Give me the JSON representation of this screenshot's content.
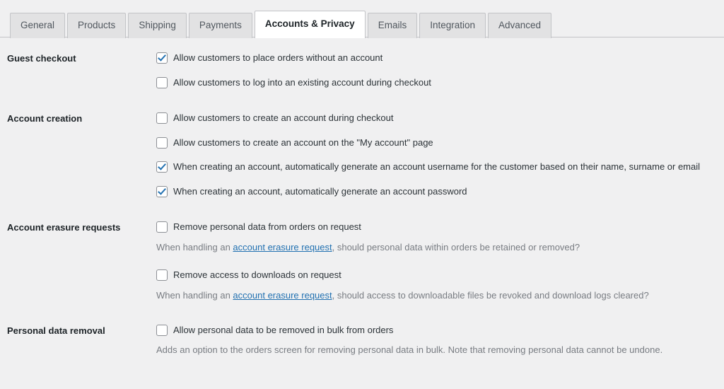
{
  "tabs": [
    {
      "label": "General",
      "active": false
    },
    {
      "label": "Products",
      "active": false
    },
    {
      "label": "Shipping",
      "active": false
    },
    {
      "label": "Payments",
      "active": false
    },
    {
      "label": "Accounts & Privacy",
      "active": true
    },
    {
      "label": "Emails",
      "active": false
    },
    {
      "label": "Integration",
      "active": false
    },
    {
      "label": "Advanced",
      "active": false
    }
  ],
  "colors": {
    "page_background": "#f0f0f1",
    "tab_inactive_background": "#e2e2e3",
    "tab_active_background": "#ffffff",
    "border": "#c3c4c7",
    "checkmark": "#2271b1",
    "link": "#2271b1",
    "label_text": "#1d2327",
    "body_text": "#2c3338",
    "description_text": "#787c82"
  },
  "sections": {
    "guest_checkout": {
      "label": "Guest checkout",
      "options": [
        {
          "label": "Allow customers to place orders without an account",
          "checked": true
        },
        {
          "label": "Allow customers to log into an existing account during checkout",
          "checked": false
        }
      ]
    },
    "account_creation": {
      "label": "Account creation",
      "options": [
        {
          "label": "Allow customers to create an account during checkout",
          "checked": false
        },
        {
          "label": "Allow customers to create an account on the \"My account\" page",
          "checked": false
        },
        {
          "label": "When creating an account, automatically generate an account username for the customer based on their name, surname or email",
          "checked": true
        },
        {
          "label": "When creating an account, automatically generate an account password",
          "checked": true
        }
      ]
    },
    "account_erasure": {
      "label": "Account erasure requests",
      "options": [
        {
          "label": "Remove personal data from orders on request",
          "checked": false,
          "desc_before": "When handling an ",
          "desc_link": "account erasure request",
          "desc_after": ", should personal data within orders be retained or removed?"
        },
        {
          "label": "Remove access to downloads on request",
          "checked": false,
          "desc_before": "When handling an ",
          "desc_link": "account erasure request",
          "desc_after": ", should access to downloadable files be revoked and download logs cleared?"
        }
      ]
    },
    "personal_data_removal": {
      "label": "Personal data removal",
      "options": [
        {
          "label": "Allow personal data to be removed in bulk from orders",
          "checked": false,
          "desc_before": "Adds an option to the orders screen for removing personal data in bulk. Note that removing personal data cannot be undone.",
          "desc_link": "",
          "desc_after": ""
        }
      ]
    }
  }
}
